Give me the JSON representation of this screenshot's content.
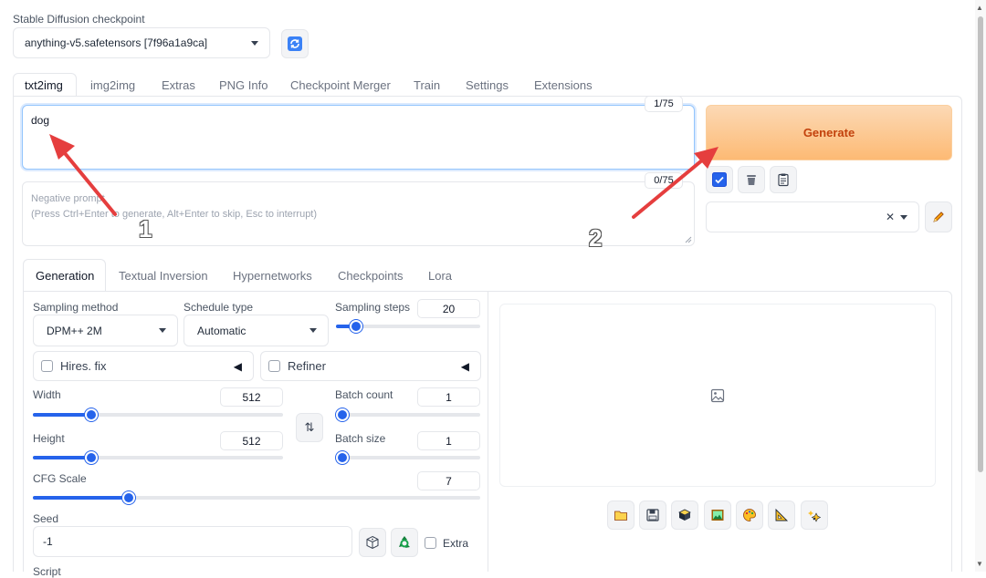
{
  "checkpoint": {
    "label": "Stable Diffusion checkpoint",
    "value": "anything-v5.safetensors [7f96a1a9ca]"
  },
  "main_tabs": [
    {
      "label": "txt2img"
    },
    {
      "label": "img2img"
    },
    {
      "label": "Extras"
    },
    {
      "label": "PNG Info"
    },
    {
      "label": "Checkpoint Merger"
    },
    {
      "label": "Train"
    },
    {
      "label": "Settings"
    },
    {
      "label": "Extensions"
    }
  ],
  "prompt": {
    "value": "dog",
    "token_count": "1/75"
  },
  "negative_prompt": {
    "placeholder": "Negative prompt\n(Press Ctrl+Enter to generate, Alt+Enter to skip, Esc to interrupt)",
    "token_count": "0/75"
  },
  "generate": {
    "label": "Generate"
  },
  "sub_tabs": [
    {
      "label": "Generation"
    },
    {
      "label": "Textual Inversion"
    },
    {
      "label": "Hypernetworks"
    },
    {
      "label": "Checkpoints"
    },
    {
      "label": "Lora"
    }
  ],
  "generation": {
    "sampling_method": {
      "label": "Sampling method",
      "value": "DPM++ 2M"
    },
    "schedule_type": {
      "label": "Schedule type",
      "value": "Automatic"
    },
    "sampling_steps": {
      "label": "Sampling steps",
      "value": "20",
      "fraction": 0.14
    },
    "hires_fix": {
      "label": "Hires. fix"
    },
    "refiner": {
      "label": "Refiner"
    },
    "width": {
      "label": "Width",
      "value": "512",
      "fraction": 0.235
    },
    "height": {
      "label": "Height",
      "value": "512",
      "fraction": 0.235
    },
    "batch_count": {
      "label": "Batch count",
      "value": "1",
      "fraction": 0.0
    },
    "batch_size": {
      "label": "Batch size",
      "value": "1",
      "fraction": 0.0
    },
    "cfg_scale": {
      "label": "CFG Scale",
      "value": "7",
      "fraction": 0.214
    },
    "seed": {
      "label": "Seed",
      "value": "-1"
    },
    "extra": {
      "label": "Extra"
    },
    "script": {
      "label": "Script"
    }
  },
  "annotations": {
    "one": "1",
    "two": "2",
    "color": "#e53e3e"
  },
  "colors": {
    "accent": "#2563eb",
    "generate_from": "#fcd2a8",
    "generate_to": "#fdba74",
    "generate_text": "#c2410c"
  }
}
